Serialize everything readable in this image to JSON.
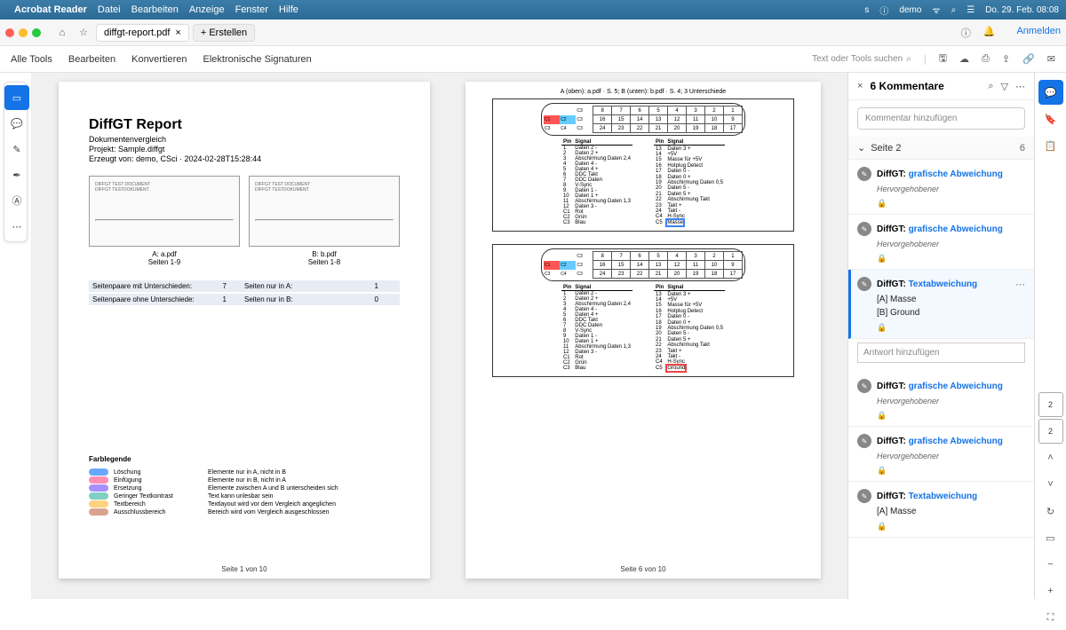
{
  "menubar": {
    "app": "Acrobat Reader",
    "items": [
      "Datei",
      "Bearbeiten",
      "Anzeige",
      "Fenster",
      "Hilfe"
    ],
    "user": "demo",
    "clock": "Do. 29. Feb. 08:08"
  },
  "tabbar": {
    "filename": "diffgt-report.pdf",
    "create": "+  Erstellen",
    "signin": "Anmelden"
  },
  "toolbar": {
    "items": [
      "Alle Tools",
      "Bearbeiten",
      "Konvertieren",
      "Elektronische Signaturen"
    ],
    "search": "Text oder Tools suchen"
  },
  "page1": {
    "title": "DiffGT Report",
    "subtitle": "Dokumentenvergleich",
    "project": "Projekt: Sample.diffgt",
    "created": "Erzeugt von: demo, CSci · 2024-02-28T15:28:44",
    "thumbA": {
      "line1": "DIFFGT TEST DOCUMENT",
      "line2": "DIFFGT TESTDOKUMENT",
      "name": "A: a.pdf",
      "pages": "Seiten 1-9"
    },
    "thumbB": {
      "line1": "DIFFGT TEST DOCUMENT",
      "line2": "DIFFGT TESTDOKUMENT",
      "name": "B: b.pdf",
      "pages": "Seiten 1-8"
    },
    "stats": [
      {
        "k1": "Seitenpaare mit Unterschieden:",
        "v1": "7",
        "k2": "Seiten nur in A:",
        "v2": "1"
      },
      {
        "k1": "Seitenpaare ohne Unterschiede:",
        "v1": "1",
        "k2": "Seiten nur in B:",
        "v2": "0"
      }
    ],
    "legend_title": "Farblegende",
    "legend": [
      {
        "c": "#6aa7ff",
        "l": "Löschung",
        "r": "Elemente nur in A, nicht in B"
      },
      {
        "c": "#ff8fb3",
        "l": "Einfügung",
        "r": "Elemente nur in B, nicht in A"
      },
      {
        "c": "#a88fff",
        "l": "Ersetzung",
        "r": "Elemente zwischen A und B unterscheiden sich"
      },
      {
        "c": "#7fd0c3",
        "l": "Geringer Textkontrast",
        "r": "Text kann unlesbar sein"
      },
      {
        "c": "#ffd27f",
        "l": "Textbereich",
        "r": "Textlayout wird vor dem Vergleich angeglichen"
      },
      {
        "c": "#d9a48f",
        "l": "Ausschlussbereich",
        "r": "Bereich wird vom Vergleich ausgeschlossen"
      }
    ],
    "footer": "Seite 1 von 10"
  },
  "page2": {
    "caption": "A (oben): a.pdf · S. 5; B (unten): b.pdf · S. 4; 3 Unterschiede",
    "diagram_rows": [
      [
        "8",
        "7",
        "6",
        "5",
        "4",
        "3",
        "2",
        "1"
      ],
      [
        "16",
        "15",
        "14",
        "13",
        "12",
        "11",
        "10",
        "9"
      ],
      [
        "24",
        "23",
        "22",
        "21",
        "20",
        "19",
        "18",
        "17"
      ]
    ],
    "diagram_labels": [
      "C1",
      "C2",
      "C3",
      "C4",
      "C5"
    ],
    "pinsA": {
      "head": [
        "Pin",
        "Signal"
      ],
      "rows": [
        [
          "1",
          "Daten 2 -"
        ],
        [
          "2",
          "Daten 2 +"
        ],
        [
          "3",
          "Abschirmung Daten 2,4"
        ],
        [
          "4",
          "Daten 4 -"
        ],
        [
          "5",
          "Daten 4 +"
        ],
        [
          "6",
          "DDC Takt"
        ],
        [
          "7",
          "DDC Daten"
        ],
        [
          "8",
          "V-Sync"
        ],
        [
          "9",
          "Daten 1 -"
        ],
        [
          "10",
          "Daten 1 +"
        ],
        [
          "11",
          "Abschirmung Daten 1,3"
        ],
        [
          "12",
          "Daten 3 -"
        ],
        [
          "C1",
          "Rot"
        ],
        [
          "C2",
          "Grün"
        ],
        [
          "C3",
          "Blau"
        ]
      ]
    },
    "pinsB": {
      "head": [
        "Pin",
        "Signal"
      ],
      "rows": [
        [
          "13",
          "Daten 3 +"
        ],
        [
          "14",
          "+5V"
        ],
        [
          "15",
          "Masse für +5V"
        ],
        [
          "16",
          "Hotplug Detect"
        ],
        [
          "17",
          "Daten 0 -"
        ],
        [
          "18",
          "Daten 0 +"
        ],
        [
          "19",
          "Abschirmung Daten 0,5"
        ],
        [
          "20",
          "Daten 5 -"
        ],
        [
          "21",
          "Daten 5 +"
        ],
        [
          "22",
          "Abschirmung Takt"
        ],
        [
          "23",
          "Takt +"
        ],
        [
          "24",
          "Takt -"
        ],
        [
          "C4",
          "H-Sync"
        ],
        [
          "C5",
          "Masse"
        ]
      ]
    },
    "pinsB_lower_diff": "Ground",
    "footer": "Seite 6 von 10"
  },
  "comments": {
    "title": "6 Kommentare",
    "add": "Kommentar hinzufügen",
    "section": "Seite 2",
    "section_count": "6",
    "reply": "Antwort hinzufügen",
    "items": [
      {
        "author": "DiffGT:",
        "type": "grafische Abweichung",
        "detail": "Hervorgehobener"
      },
      {
        "author": "DiffGT:",
        "type": "grafische Abweichung",
        "detail": "Hervorgehobener"
      },
      {
        "author": "DiffGT:",
        "type": "Textabweichung",
        "detail_a": "[A] Masse",
        "detail_b": "[B] Ground",
        "selected": true
      },
      {
        "author": "DiffGT:",
        "type": "grafische Abweichung",
        "detail": "Hervorgehobener"
      },
      {
        "author": "DiffGT:",
        "type": "grafische Abweichung",
        "detail": "Hervorgehobener"
      },
      {
        "author": "DiffGT:",
        "type": "Textabweichung",
        "detail_a": "[A] Masse"
      }
    ]
  },
  "rstrip": {
    "page_badge": "2",
    "count_badge": "2"
  }
}
